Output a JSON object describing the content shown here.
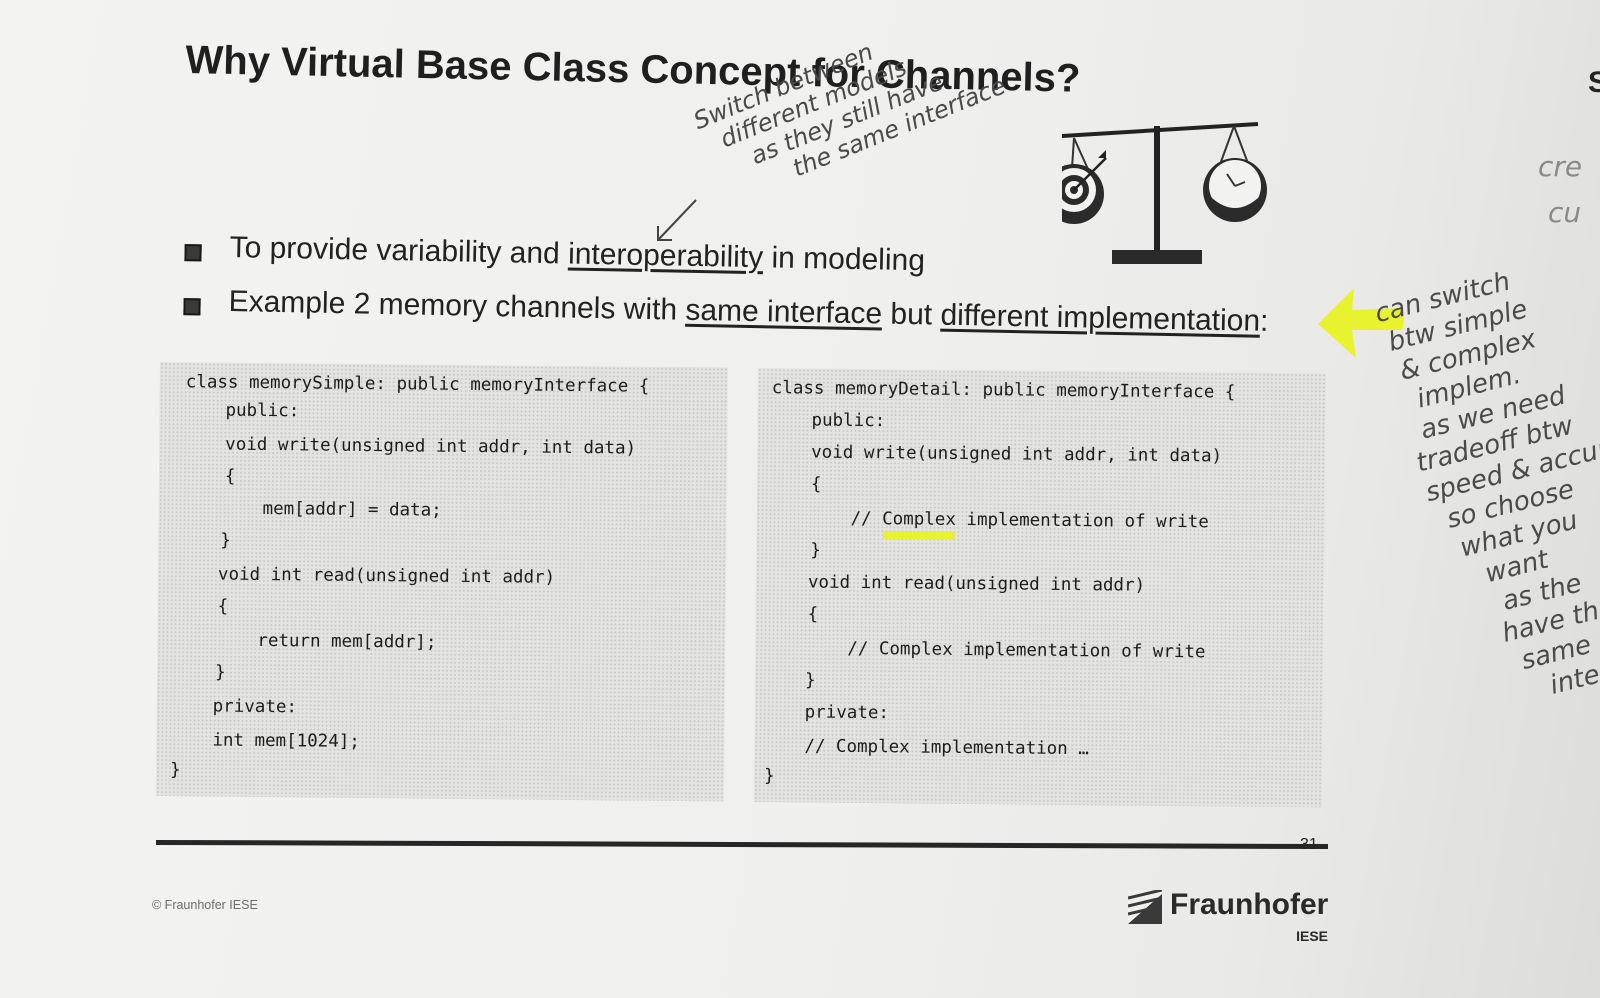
{
  "slide": {
    "title": "Why Virtual Base Class Concept for Channels?",
    "bullets": [
      {
        "pre": "To provide variability and ",
        "u1": "interoperability",
        "mid": " in modeling",
        "u2": "",
        "post": ""
      },
      {
        "pre": "Example 2 memory channels with ",
        "u1": "same interface",
        "mid": " but ",
        "u2": "different implementation",
        "post": ":"
      }
    ],
    "page_number": "31",
    "copyright": "© Fraunhofer IESE",
    "logo": {
      "name": "Fraunhofer",
      "sub": "IESE"
    },
    "edge_letter": "S"
  },
  "code_left": {
    "lines": [
      "class memorySimple: public memoryInterface {",
      "public:",
      "void write(unsigned int addr, int data)",
      "{",
      "mem[addr] = data;",
      "}",
      "void int read(unsigned int addr)",
      "{",
      "return mem[addr];",
      "}",
      "private:",
      "int mem[1024];",
      "}"
    ]
  },
  "code_right": {
    "lines": [
      "class memoryDetail: public memoryInterface {",
      "public:",
      "void write(unsigned int addr, int data)",
      "{",
      "// ",
      "Complex",
      " implementation of write",
      "}",
      "void int read(unsigned int addr)",
      "{",
      "// Complex implementation of write",
      "}",
      "private:",
      "// Complex implementation …",
      "}"
    ]
  },
  "handwriting": {
    "top_note": [
      "Switch between",
      "different models",
      "as they still have",
      "the same interface"
    ],
    "right_note": [
      "can switch",
      "btw simple",
      "& complex",
      "implem.",
      "as we need",
      "tradeoff btw",
      "speed & accuracy",
      "so choose",
      "what you",
      "want",
      "as the",
      "have the",
      "same",
      "interface"
    ],
    "edge_scribble": [
      "cre",
      "cu"
    ]
  },
  "colors": {
    "highlighter": "#e8f224",
    "text": "#222222",
    "code_bg": "#e3e3e1"
  },
  "icons": [
    "balance-scale-icon",
    "target-icon",
    "clock-icon",
    "highlighter-arrow-icon"
  ]
}
